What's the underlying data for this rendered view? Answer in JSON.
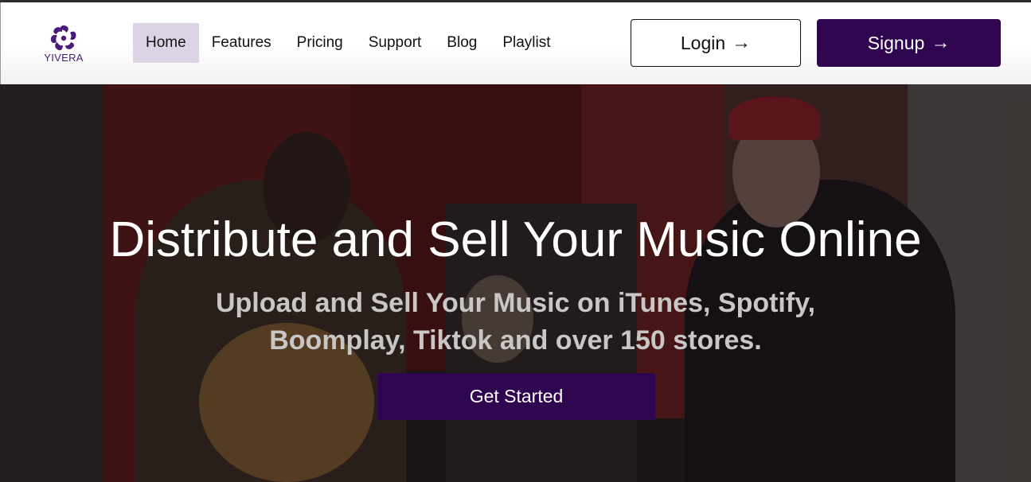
{
  "brand": {
    "name": "YIVERA",
    "logo_icon": "swirl-flower-icon",
    "color": "#4a1a7a"
  },
  "nav": {
    "items": [
      {
        "label": "Home",
        "active": true
      },
      {
        "label": "Features",
        "active": false
      },
      {
        "label": "Pricing",
        "active": false
      },
      {
        "label": "Support",
        "active": false
      },
      {
        "label": "Blog",
        "active": false
      },
      {
        "label": "Playlist",
        "active": false
      }
    ]
  },
  "auth": {
    "login_label": "Login",
    "signup_label": "Signup",
    "arrow_icon": "arrow-right-icon"
  },
  "hero": {
    "title": "Distribute and Sell Your Music Online",
    "subtitle_line1": "Upload and Sell Your Music on iTunes, Spotify,",
    "subtitle_line2": "Boomplay, Tiktok and over 150 stores.",
    "cta_label": "Get Started",
    "background_image": "photo-of-musicians"
  },
  "colors": {
    "accent": "#2f0550",
    "nav_active_bg": "#ddd3e6"
  }
}
